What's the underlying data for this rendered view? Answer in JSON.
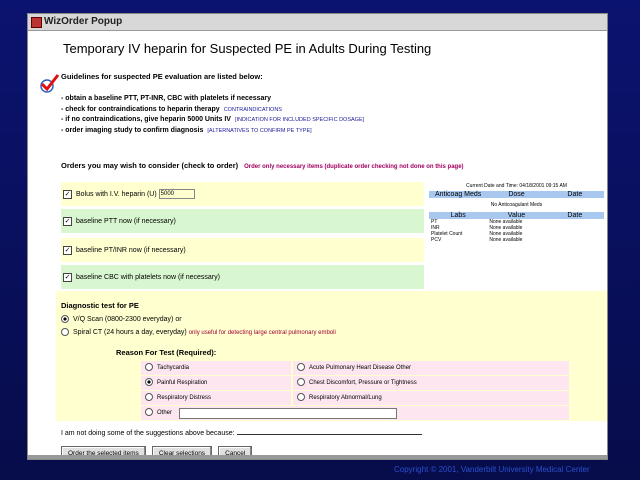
{
  "window": {
    "title": "WizOrder Popup"
  },
  "page_title": "Temporary IV heparin for Suspected PE in Adults During Testing",
  "guidelines": {
    "title": "Guidelines for suspected PE evaluation are listed below:",
    "items": [
      {
        "text": "- obtain a baseline PTT, PT-INR, CBC with platelets if necessary",
        "link": ""
      },
      {
        "text": "- check for contraindications to heparin therapy",
        "link": "CONTRAINDICATIONS"
      },
      {
        "text": "- if no contraindications, give heparin 5000 Units IV",
        "link": "[INDICATION FOR INCLUDED SPECIFIC DOSAGE]"
      },
      {
        "text": "- order imaging study to confirm diagnosis",
        "link": "[ALTERNATIVES TO CONFIRM PE TYPE]"
      }
    ]
  },
  "orders": {
    "heading": "Orders you may wish to consider (check to order)",
    "note": "Order only necessary items (duplicate order checking not done on this page)",
    "items": [
      {
        "label": "Bolus with I.V. heparin (U)",
        "value": "5000",
        "checked": true
      },
      {
        "label": "baseline PTT now (if necessary)",
        "checked": true
      },
      {
        "label": "baseline PT/INR now (if necessary)",
        "checked": true
      },
      {
        "label": "baseline CBC with platelets now (if necessary)",
        "checked": true
      }
    ]
  },
  "panel": {
    "top": "Current Date and Time: 04/18/2001 09:15 AM",
    "anticoag_headers": [
      "Anticoag Meds",
      "Dose",
      "Date"
    ],
    "anticoag_none": "No Anticoagulant Meds",
    "lab_headers": [
      "Labs",
      "Value",
      "Date"
    ],
    "labs": [
      {
        "name": "PT",
        "value": "None available"
      },
      {
        "name": "INR",
        "value": "None available"
      },
      {
        "name": "Platelet Count",
        "value": "None available"
      },
      {
        "name": "PCV",
        "value": "None available"
      }
    ]
  },
  "diagnostic": {
    "title": "Diagnostic test for PE",
    "options": [
      {
        "label": "V/Q Scan (0800-2300 everyday)",
        "suffix": "or",
        "selected": true,
        "note": ""
      },
      {
        "label": "Spiral CT (24 hours a day, everyday)",
        "suffix": "",
        "selected": false,
        "note": "only useful for detecting large central pulmonary emboli"
      }
    ],
    "reason_title": "Reason For Test (Required):",
    "reasons": [
      "Tachycardia",
      "Acute Pulmonary Heart Disease Other",
      "Painful Respiration",
      "Chest Discomfort, Pressure or Tightness",
      "Respiratory Distress",
      "Respiratory Abnormal/Lung",
      "Other"
    ]
  },
  "not_doing": "I am not doing some of the suggestions above because:",
  "buttons": [
    "Order the selected items",
    "Clear selections",
    "Cancel"
  ],
  "copyright": "Copyright © 2001, Vanderbilt University Medical Center"
}
